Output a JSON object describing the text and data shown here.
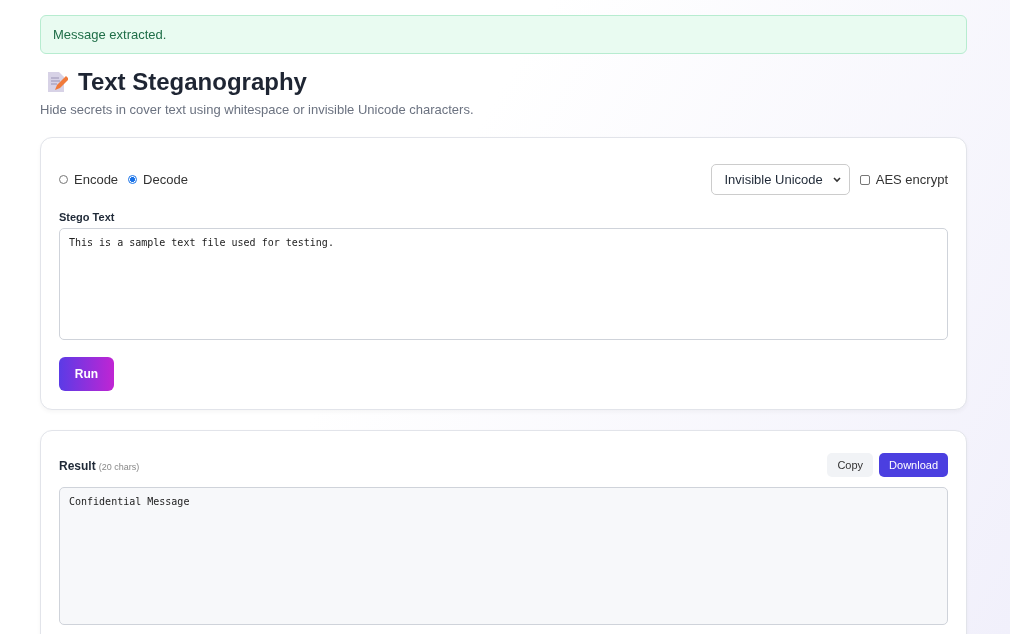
{
  "alert": {
    "message": "Message extracted."
  },
  "header": {
    "title": "Text Steganography",
    "subtitle": "Hide secrets in cover text using whitespace or invisible Unicode characters."
  },
  "form": {
    "modes": [
      {
        "label": "Encode",
        "selected": false
      },
      {
        "label": "Decode",
        "selected": true
      }
    ],
    "method": "Invisible Unicode",
    "encrypt": {
      "label": "AES encrypt",
      "checked": false
    },
    "field": {
      "label": "Stego Text",
      "value": "This is a sample text file used for testing."
    },
    "run_button": "Run"
  },
  "result": {
    "label": "Result",
    "count": "(20 chars)",
    "copy_button": "Copy",
    "download_button": "Download",
    "value": "Confidential Message"
  }
}
